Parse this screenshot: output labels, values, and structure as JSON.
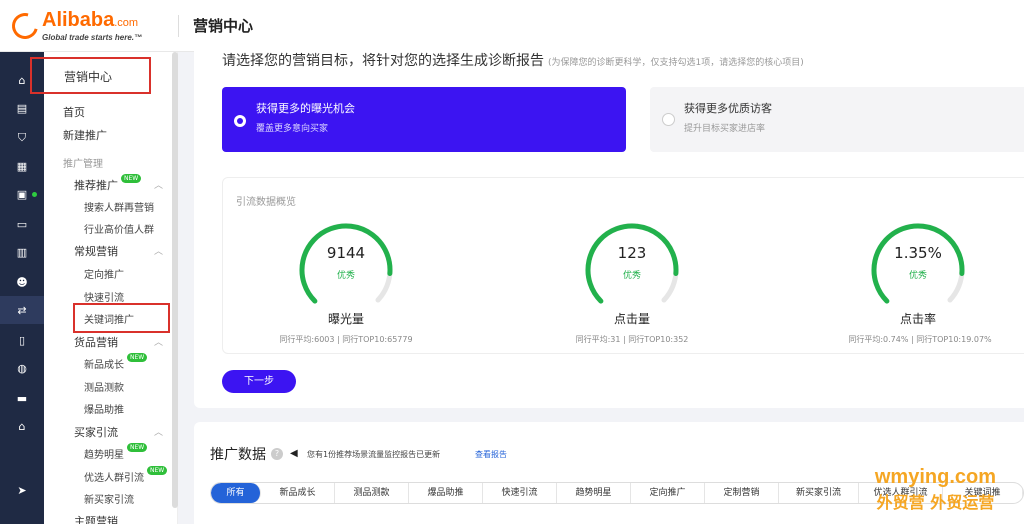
{
  "header": {
    "logo_name": "Alibaba",
    "logo_suffix": ".com",
    "logo_tagline": "Global trade starts here.™",
    "title": "营销中心"
  },
  "sidebar": {
    "heading": "营销中心",
    "items": [
      {
        "label": "首页",
        "type": "item"
      },
      {
        "label": "新建推广",
        "type": "item"
      },
      {
        "label": "推广管理",
        "type": "group"
      },
      {
        "label": "推荐推广",
        "type": "section",
        "badge": "NEW"
      },
      {
        "label": "搜索人群再营销",
        "type": "sub"
      },
      {
        "label": "行业高价值人群",
        "type": "sub"
      },
      {
        "label": "常规营销",
        "type": "section"
      },
      {
        "label": "定向推广",
        "type": "sub"
      },
      {
        "label": "快速引流",
        "type": "sub"
      },
      {
        "label": "关键词推广",
        "type": "sub"
      },
      {
        "label": "货品营销",
        "type": "section"
      },
      {
        "label": "新品成长",
        "type": "sub",
        "badge": "NEW"
      },
      {
        "label": "测品测款",
        "type": "sub"
      },
      {
        "label": "爆品助推",
        "type": "sub"
      },
      {
        "label": "买家引流",
        "type": "section"
      },
      {
        "label": "趋势明星",
        "type": "sub",
        "badge": "NEW"
      },
      {
        "label": "优选人群引流",
        "type": "sub",
        "badge": "NEW"
      },
      {
        "label": "新买家引流",
        "type": "sub"
      },
      {
        "label": "主题营销",
        "type": "section"
      }
    ]
  },
  "goal": {
    "title": "请选择您的营销目标，将针对您的选择生成诊断报告",
    "hint": "(为保障您的诊断更科学，仅支持勾选1项，请选择您的核心项目)",
    "options": [
      {
        "label": "获得更多的曝光机会",
        "desc": "覆盖更多意向买家",
        "selected": true
      },
      {
        "label": "获得更多优质访客",
        "desc": "提升目标买家进店率",
        "selected": false
      }
    ]
  },
  "overview": {
    "title": "引流数据概览",
    "metrics": [
      {
        "value": "9144",
        "tag": "优秀",
        "name": "曝光量",
        "avg": "同行平均:6003 | 同行TOP10:65779",
        "level": 0.85
      },
      {
        "value": "123",
        "tag": "优秀",
        "name": "点击量",
        "avg": "同行平均:31 | 同行TOP10:352",
        "level": 0.85
      },
      {
        "value": "1.35%",
        "tag": "优秀",
        "name": "点击率",
        "avg": "同行平均:0.74% | 同行TOP10:19.07%",
        "level": 0.85
      }
    ]
  },
  "next_button": "下一步",
  "promo": {
    "title": "推广数据",
    "note": "您有1份推荐场景流量监控报告已更新",
    "link": "查看报告",
    "tabs": [
      "所有",
      "新品成长",
      "测品测款",
      "爆品助推",
      "快速引流",
      "趋势明星",
      "定向推广",
      "定制营销",
      "新买家引流",
      "优选人群引流",
      "关键词推"
    ]
  },
  "watermark": {
    "line1": "wmying.com",
    "line2": "外贸营 外贸运营"
  },
  "colors": {
    "brand": "#ff6a00",
    "primary": "#3c14f2",
    "success": "#22b14c",
    "link": "#2463d8",
    "highlight_box": "#d9312b"
  }
}
